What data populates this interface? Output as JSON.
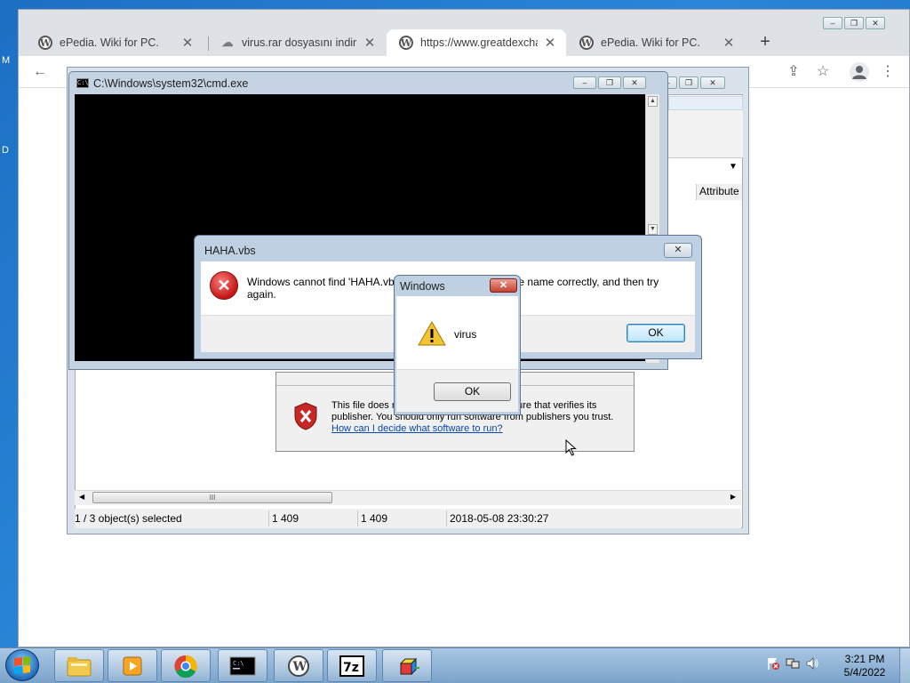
{
  "desktop": {
    "fragment_top": "M",
    "fragment_mid": "D"
  },
  "browser": {
    "tabs": [
      {
        "title": "ePedia. Wiki for PC.",
        "icon": "wordpress-icon"
      },
      {
        "title": "virus.rar dosyasını indir - ",
        "icon": "cloud-icon"
      },
      {
        "title": "https://www.greatdexchar",
        "icon": "wordpress-icon"
      },
      {
        "title": "ePedia. Wiki for PC.",
        "icon": "wordpress-icon"
      }
    ],
    "new_tab": "+",
    "close_glyph": "✕"
  },
  "explorer": {
    "attribute_header": "Attribute",
    "status": {
      "selection": "1 / 3 object(s) selected",
      "size": "1 409",
      "packed": "1 409",
      "modified": "2018-05-08 23:30:27"
    },
    "scroll_grip": "III"
  },
  "security_warning": {
    "text": "This file does not have a valid digital signature that verifies its publisher.  You should only run software from publishers you trust.",
    "link": "How can I decide what software to run?"
  },
  "cmd": {
    "title": "C:\\Windows\\system32\\cmd.exe",
    "icon_text": "C:\\"
  },
  "haha_dialog": {
    "title": "HAHA.vbs",
    "message": "Windows cannot find 'HAHA.vbs'. Make sure you typed the name correctly, and then try again.",
    "ok_label": "OK"
  },
  "windows_dialog": {
    "title": "Windows",
    "message": "virus",
    "ok_label": "OK"
  },
  "taskbar": {
    "clock_time": "3:21 PM",
    "clock_date": "5/4/2022",
    "pinned": [
      "explorer-icon",
      "media-player-icon",
      "chrome-icon",
      "cmd-icon",
      "wordpress-icon",
      "7zip-icon",
      "app-cube-icon"
    ]
  },
  "colors": {
    "taskbar": "#7aa3cb",
    "error_red": "#c41616",
    "link_blue": "#0645ad",
    "cmd_bg": "#000000"
  }
}
